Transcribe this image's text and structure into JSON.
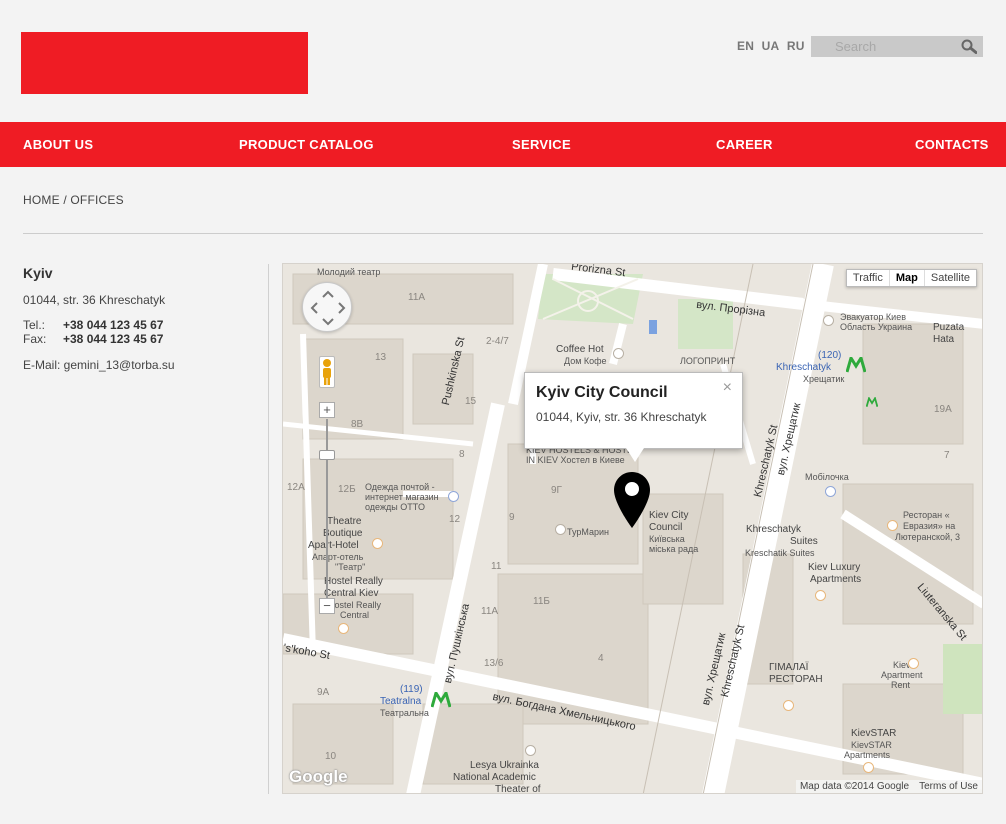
{
  "header": {
    "languages": [
      "EN",
      "UA",
      "RU"
    ],
    "search_placeholder": "Search",
    "accent_color": "#ef1c24"
  },
  "nav": {
    "items": [
      "ABOUT US",
      "PRODUCT CATALOG",
      "SERVICE",
      "CAREER",
      "CONTACTS"
    ]
  },
  "breadcrumb": "HOME / OFFICES",
  "office": {
    "city": "Kyiv",
    "address": "01044, str. 36 Khreschatyk",
    "tel_label": "Tel.:",
    "tel": "+38 044 123 45 67",
    "fax_label": "Fax:",
    "fax": "+38 044 123 45 67",
    "email_text": "E-Mail: gemini_13@torba.su"
  },
  "map": {
    "type_buttons": [
      "Traffic",
      "Map",
      "Satellite"
    ],
    "active_type": "Map",
    "info_title": "Kyiv City Council",
    "info_address": "01044, Kyiv, str. 36 Khreschatyk",
    "attribution": "Map data ©2014 Google",
    "terms": "Terms of Use",
    "google_logo": "Google",
    "labels": {
      "molodyi": "Молодий театр",
      "prorizna_st": "Prorizna St",
      "prorizna_ua": "вул. Прорізна",
      "coffee_hot": "Coffee Hot",
      "coffee_hot_ru": "Дом Кофе",
      "logoprint": "ЛОГОПРИНТ",
      "evacuator_1": "Эвакуатор Киев",
      "evacuator_2": "Область Украина",
      "puzata_1": "Puzata",
      "puzata_2": "Hata",
      "khreschatyk_metro": "Khreschatyk",
      "khreschatyk_metro_ua": "Хрещатик",
      "metro_120": "(120)",
      "hostel_kiev_1": "KIEV HOSTELS & HOSTEL",
      "hostel_kiev_2": "IN KIEV Хостел в Киеве",
      "pushkinska": "Pushkinska St",
      "clothes_1": "Одежда почтой -",
      "clothes_2": "интернет магазин",
      "clothes_3": "одежды OTTO",
      "theatre_1": "Theatre",
      "theatre_2": "Boutique",
      "theatre_3": "Apart-Hotel",
      "theatre_4": "Апарт-отель",
      "theatre_5": "\"Театр\"",
      "turmarin": "ТурМарин",
      "council_1": "Kiev City",
      "council_2": "Council",
      "council_3": "Київська",
      "council_4": "міська рада",
      "mobilochka": "Мобілочка",
      "khreschatyk_st_1": "Khreschatyk St",
      "khreschatyk_st_ua_1": "вул. Хрещатик",
      "suites_1": "Khreschatyk",
      "suites_2": "Suites",
      "suites_3": "Kreschatik Suites",
      "luxury_1": "Kiev Luxury",
      "luxury_2": "Apartments",
      "restoran_1": "Ресторан «",
      "restoran_2": "Евразия» на",
      "restoran_3": "Лютеранской, 3",
      "hostel_really_1": "Hostel Really",
      "hostel_really_2": "Central Kiev",
      "hostel_really_3": "Hostel Really",
      "hostel_really_4": "Central",
      "pushkinska_ua": "вул. Пушкінська",
      "khreschatyk_st_2": "Khreschatyk St",
      "khreschatyk_st_ua_2": "вул. Хрещатик",
      "luteranska": "Liuteranska St",
      "tskoho": "'s'koho St",
      "bohdana": "вул. Богдана Хмельницького",
      "metro_119": "(119)",
      "teatralna": "Teatralna",
      "teatralna_ua": "Театральна",
      "himalai_1": "ГІМАЛАЇ",
      "himalai_2": "РЕСТОРАН",
      "apartment_1": "Kiev",
      "apartment_2": "Apartment",
      "apartment_3": "Rent",
      "kievstar_1": "KievSTAR",
      "kievstar_2": "KievSTAR",
      "kievstar_3": "Apartments",
      "lesya_1": "Lesya Ukrainka",
      "lesya_2": "National Academic",
      "lesya_3": "Theater of"
    },
    "numbers": {
      "n11a_top": "11A",
      "n13": "13",
      "n247": "2-4/7",
      "n15": "15",
      "n8b": "8B",
      "n8": "8",
      "n12a": "12A",
      "n12b": "12Б",
      "n12": "12",
      "n9": "9",
      "n9g": "9Г",
      "n11": "11",
      "n11a": "11A",
      "n11b": "11Б",
      "n136": "13/6",
      "n4": "4",
      "n9a": "9A",
      "n10": "10",
      "n19a": "19A",
      "n7": "7"
    }
  }
}
